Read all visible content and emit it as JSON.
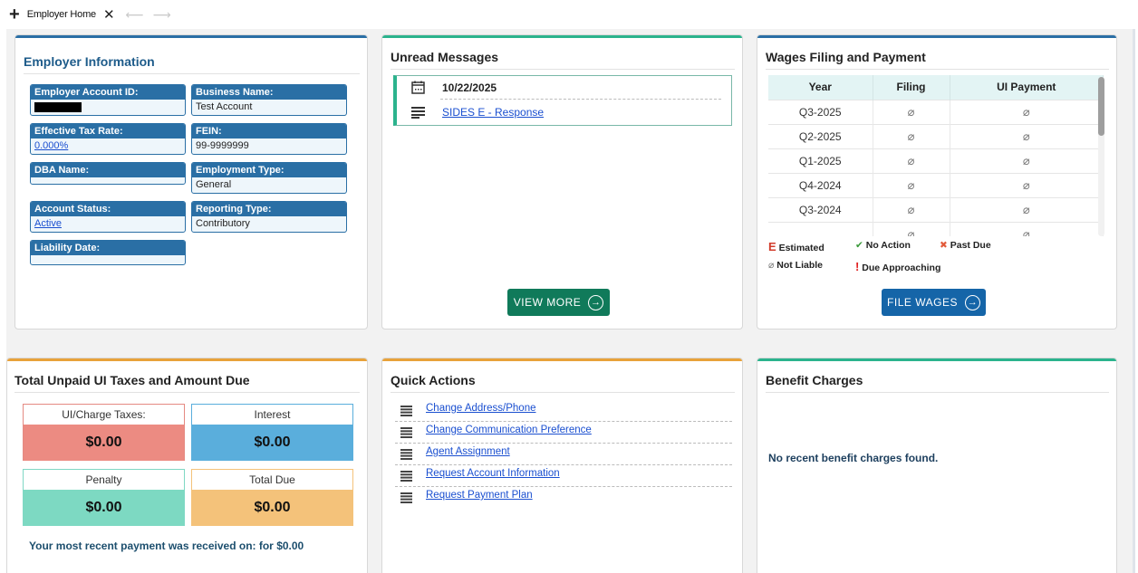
{
  "tab": {
    "label": "Employer Home"
  },
  "employer": {
    "title": "Employer Information",
    "account_id_label": "Employer Account ID:",
    "business_name_label": "Business Name:",
    "business_name": "Test Account",
    "tax_rate_label": "Effective Tax Rate:",
    "tax_rate": "0.000%",
    "fein_label": "FEIN:",
    "fein": "99-9999999",
    "dba_label": "DBA Name:",
    "dba": "",
    "employment_type_label": "Employment Type:",
    "employment_type": "General",
    "account_status_label": "Account Status:",
    "account_status": "Active",
    "reporting_type_label": "Reporting Type:",
    "reporting_type": "Contributory",
    "liability_label": "Liability Date:",
    "liability": ""
  },
  "messages": {
    "title": "Unread Messages",
    "date": "10/22/2025",
    "link": "SIDES E - Response",
    "view_more": "VIEW MORE"
  },
  "wages": {
    "title": "Wages Filing and Payment",
    "headers": [
      "Year",
      "Filing",
      "UI Payment"
    ],
    "rows": [
      {
        "year": "Q3-2025",
        "filing": "not-liable-icon",
        "payment": "not-liable-icon"
      },
      {
        "year": "Q2-2025",
        "filing": "not-liable-icon",
        "payment": "not-liable-icon"
      },
      {
        "year": "Q1-2025",
        "filing": "not-liable-icon",
        "payment": "not-liable-icon"
      },
      {
        "year": "Q4-2024",
        "filing": "not-liable-icon",
        "payment": "not-liable-icon"
      },
      {
        "year": "Q3-2024",
        "filing": "not-liable-icon",
        "payment": "not-liable-icon"
      }
    ],
    "legend": {
      "estimated": "Estimated",
      "no_action": "No Action",
      "past_due": "Past Due",
      "not_liable": "Not Liable",
      "due_approaching": "Due Approaching"
    },
    "file_button": "FILE WAGES"
  },
  "taxes": {
    "title": "Total Unpaid UI Taxes and Amount Due",
    "ui_label": "UI/Charge Taxes:",
    "ui_value": "$0.00",
    "interest_label": "Interest",
    "interest_value": "$0.00",
    "penalty_label": "Penalty",
    "penalty_value": "$0.00",
    "total_label": "Total Due",
    "total_value": "$0.00",
    "recent_payment": "Your most recent payment was received on:  for $0.00"
  },
  "quick": {
    "title": "Quick Actions",
    "items": [
      "Change Address/Phone",
      "Change Communication Preference",
      "Agent Assignment",
      "Request Account Information",
      "Request Payment Plan"
    ]
  },
  "benefit": {
    "title": "Benefit Charges",
    "empty": "No recent benefit charges found."
  },
  "colors": {
    "blue": "#2a6fa5",
    "teal": "#2bb38d",
    "orange": "#e8a23a",
    "green_button": "#107a5a",
    "blue_button": "#1565a8"
  }
}
